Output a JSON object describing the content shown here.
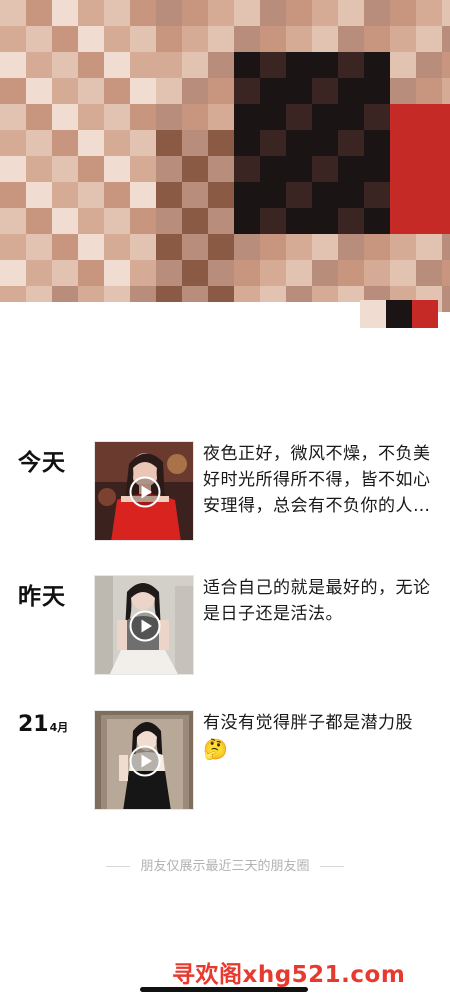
{
  "cover": {
    "icon": "pixelated-cover-photo",
    "palette": [
      "#e2c2b1",
      "#d5ab95",
      "#c8957e",
      "#8a5a45",
      "#3a2522",
      "#1a1414",
      "#c62a26",
      "#f0dcd1",
      "#b88d7c"
    ]
  },
  "posts": [
    {
      "date": "今天",
      "text": "夜色正好，微风不燥，不负美好时光所得所不得，皆不如心安理得，总会有不负你的人和事。",
      "media": "video-thumbnail",
      "colors": [
        "#5a2a22",
        "#d8231f",
        "#e9c6b6"
      ]
    },
    {
      "date": "昨天",
      "text": "适合自己的就是最好的，无论是日子还是活法。",
      "media": "video-thumbnail",
      "colors": [
        "#cfccc6",
        "#727272",
        "#e9e6e2"
      ]
    },
    {
      "date_day": "21",
      "date_month": "4月",
      "text": "有没有觉得胖子都是潜力股",
      "emoji": "🤔",
      "media": "video-thumbnail",
      "colors": [
        "#8a7a6a",
        "#1b1b1b",
        "#f0e2d6"
      ]
    }
  ],
  "footer": {
    "note": "朋友仅展示最近三天的朋友圈"
  },
  "watermark": {
    "text": "寻欢阁xhg521.com"
  }
}
